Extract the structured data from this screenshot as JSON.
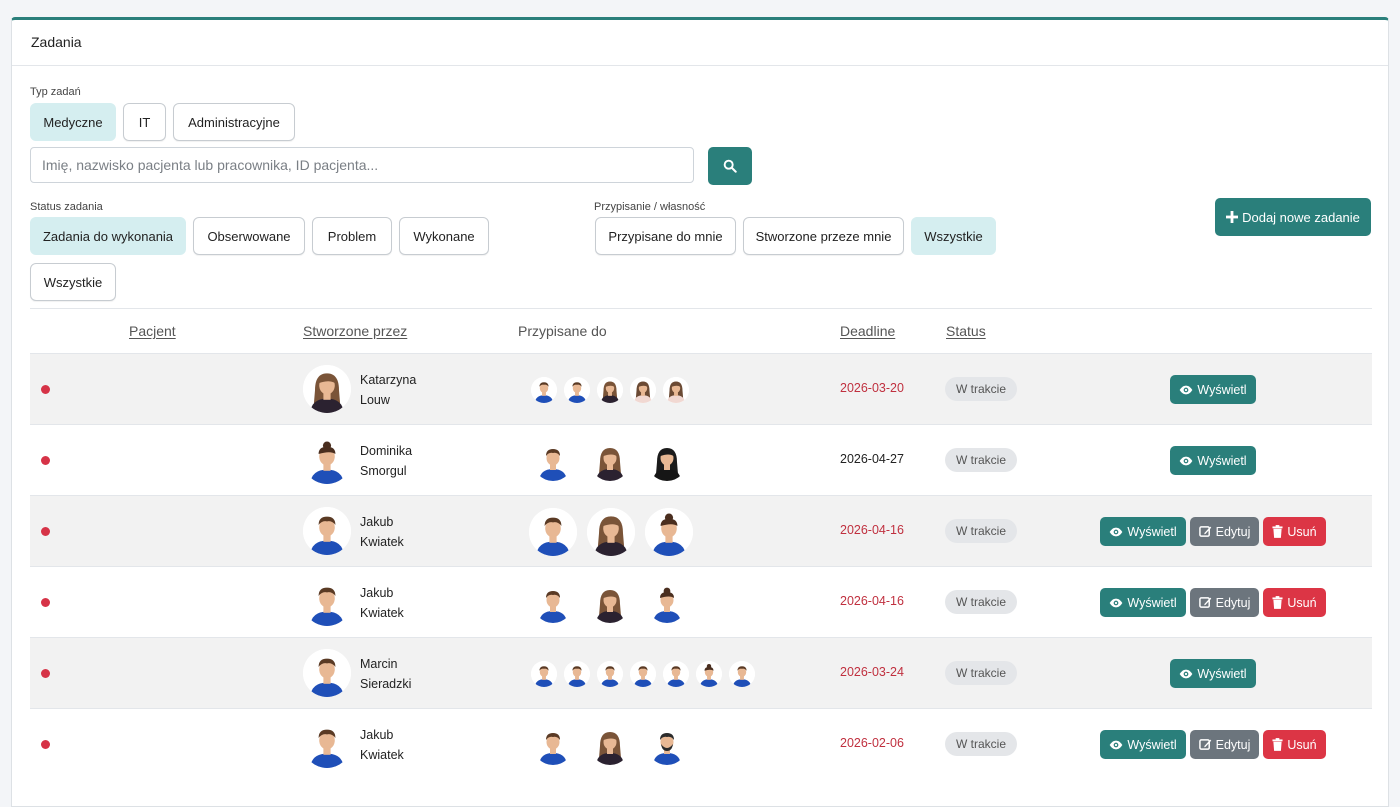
{
  "card": {
    "title": "Zadania"
  },
  "task_type": {
    "label": "Typ zadań",
    "options": [
      "Medyczne",
      "IT",
      "Administracyjne"
    ],
    "active": 0
  },
  "search": {
    "placeholder": "Imię, nazwisko pacjenta lub pracownika, ID pacjenta..."
  },
  "status_filter": {
    "label": "Status zadania",
    "options": [
      "Zadania do wykonania",
      "Obserwowane",
      "Problem",
      "Wykonane",
      "Wszystkie"
    ],
    "active": 0
  },
  "ownership_filter": {
    "label": "Przypisanie / własność",
    "options": [
      "Przypisane do mnie",
      "Stworzone przeze mnie",
      "Wszystkie"
    ],
    "active": 2
  },
  "add_button": {
    "label": "Dodaj nowe zadanie",
    "icon": "plus-icon"
  },
  "table": {
    "headers": {
      "patient": "Pacjent",
      "created_by": "Stworzone przez",
      "assigned_to": "Przypisane do",
      "deadline": "Deadline",
      "status": "Status"
    },
    "action_labels": {
      "view": "Wyświetl",
      "edit": "Edytuj",
      "delete": "Usuń"
    },
    "rows": [
      {
        "creator_first": "Katarzyna",
        "creator_last": "Louw",
        "assignees": [
          "m",
          "m",
          "f-dark",
          "f-light",
          "f-light"
        ],
        "deadline": "2026-03-20",
        "overdue": true,
        "status": "W trakcie",
        "actions": [
          "view"
        ]
      },
      {
        "creator_first": "Dominika",
        "creator_last": "Smorgul",
        "assignees": [
          "m",
          "f-dark",
          "f-black"
        ],
        "deadline": "2026-04-27",
        "overdue": false,
        "status": "W trakcie",
        "actions": [
          "view"
        ]
      },
      {
        "creator_first": "Jakub",
        "creator_last": "Kwiatek",
        "assignees": [
          "m",
          "f-dark",
          "f-blue"
        ],
        "deadline": "2026-04-16",
        "overdue": true,
        "status": "W trakcie",
        "actions": [
          "view",
          "edit",
          "delete"
        ]
      },
      {
        "creator_first": "Jakub",
        "creator_last": "Kwiatek",
        "assignees": [
          "m",
          "f-dark",
          "f-blue"
        ],
        "deadline": "2026-04-16",
        "overdue": true,
        "status": "W trakcie",
        "actions": [
          "view",
          "edit",
          "delete"
        ]
      },
      {
        "creator_first": "Marcin",
        "creator_last": "Sieradzki",
        "assignees": [
          "m",
          "m",
          "m",
          "m",
          "m",
          "f-blue",
          "m"
        ],
        "deadline": "2026-03-24",
        "overdue": true,
        "status": "W trakcie",
        "actions": [
          "view"
        ]
      },
      {
        "creator_first": "Jakub",
        "creator_last": "Kwiatek",
        "assignees": [
          "m",
          "f-dark",
          "m-beard"
        ],
        "deadline": "2026-02-06",
        "overdue": true,
        "status": "W trakcie",
        "actions": [
          "view",
          "edit",
          "delete"
        ]
      }
    ]
  },
  "colors": {
    "primary": "#2a7f7b",
    "active_filter": "#d5eef0",
    "overdue": "#c0303f",
    "delete": "#dc3545",
    "edit": "#6c757d",
    "priority_dot": "#d63347"
  }
}
